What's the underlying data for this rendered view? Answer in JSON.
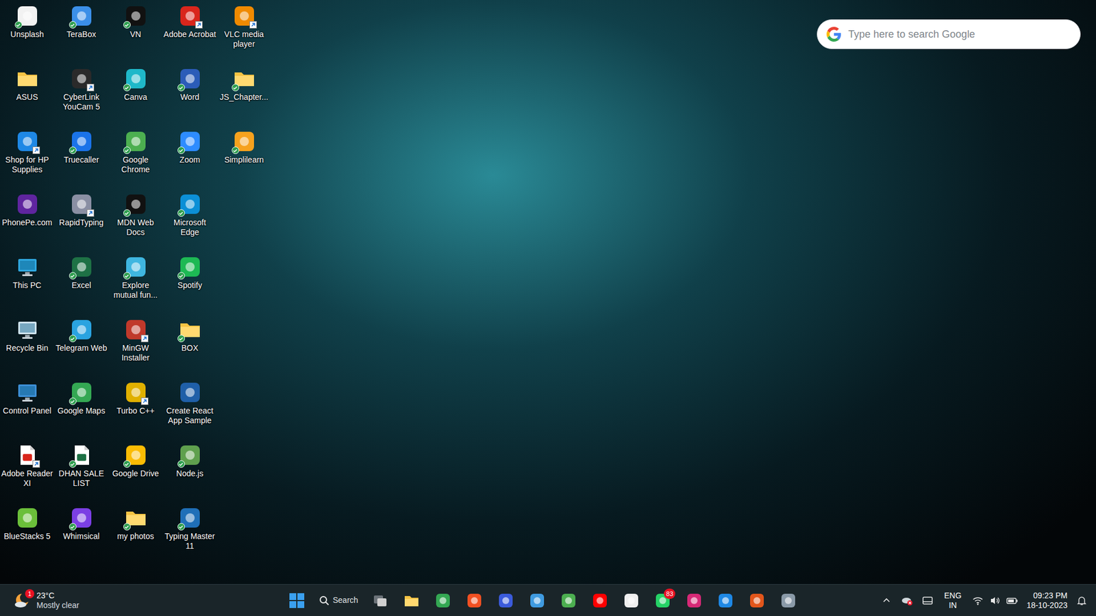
{
  "desktop": {
    "icons": [
      {
        "label": "Unsplash",
        "kind": "app",
        "color": "#f2f2f2",
        "shortcut": false,
        "synced": true
      },
      {
        "label": "ASUS",
        "kind": "folder",
        "color": "#f6c343",
        "shortcut": false,
        "synced": false
      },
      {
        "label": "Shop for HP Supplies",
        "kind": "app",
        "color": "#1e88e5",
        "shortcut": true,
        "synced": false
      },
      {
        "label": "PhonePe.com",
        "kind": "app",
        "color": "#5f259f",
        "shortcut": false,
        "synced": false
      },
      {
        "label": "This PC",
        "kind": "system",
        "color": "#2fa8e0",
        "shortcut": false,
        "synced": false
      },
      {
        "label": "Recycle Bin",
        "kind": "system",
        "color": "#cfe3ee",
        "shortcut": false,
        "synced": false
      },
      {
        "label": "Control Panel",
        "kind": "system",
        "color": "#3d8fd6",
        "shortcut": false,
        "synced": false
      },
      {
        "label": "Adobe Reader XI",
        "kind": "document",
        "color": "#d9261c",
        "shortcut": true,
        "synced": false
      },
      {
        "label": "BlueStacks 5",
        "kind": "app",
        "color": "#6bbf3a",
        "shortcut": false,
        "synced": false
      },
      {
        "label": "TeraBox",
        "kind": "app",
        "color": "#3b8fe8",
        "shortcut": false,
        "synced": true
      },
      {
        "label": "CyberLink YouCam 5",
        "kind": "app",
        "color": "#2a2a2a",
        "shortcut": true,
        "synced": false
      },
      {
        "label": "Truecaller",
        "kind": "app",
        "color": "#1a73e8",
        "shortcut": false,
        "synced": true
      },
      {
        "label": "RapidTyping",
        "kind": "app",
        "color": "#8a8fa3",
        "shortcut": true,
        "synced": false
      },
      {
        "label": "Excel",
        "kind": "app",
        "color": "#1e7145",
        "shortcut": false,
        "synced": true
      },
      {
        "label": "Telegram Web",
        "kind": "app",
        "color": "#2aa3e0",
        "shortcut": false,
        "synced": true
      },
      {
        "label": "Google Maps",
        "kind": "app",
        "color": "#34a853",
        "shortcut": false,
        "synced": true
      },
      {
        "label": "DHAN SALE LIST",
        "kind": "document",
        "color": "#1e7145",
        "shortcut": false,
        "synced": true
      },
      {
        "label": "Whimsical",
        "kind": "app",
        "color": "#7b3fe4",
        "shortcut": false,
        "synced": true
      },
      {
        "label": "VN",
        "kind": "app",
        "color": "#111111",
        "shortcut": false,
        "synced": true
      },
      {
        "label": "Canva",
        "kind": "app",
        "color": "#1fb8c9",
        "shortcut": false,
        "synced": true
      },
      {
        "label": "Google Chrome",
        "kind": "app",
        "color": "#4caf50",
        "shortcut": false,
        "synced": true
      },
      {
        "label": "MDN Web Docs",
        "kind": "app",
        "color": "#111111",
        "shortcut": false,
        "synced": true
      },
      {
        "label": "Explore mutual fun...",
        "kind": "app",
        "color": "#3fb6e0",
        "shortcut": false,
        "synced": true
      },
      {
        "label": "MinGW Installer",
        "kind": "app",
        "color": "#c0392b",
        "shortcut": true,
        "synced": false
      },
      {
        "label": "Turbo C++",
        "kind": "app",
        "color": "#e0b000",
        "shortcut": true,
        "synced": false
      },
      {
        "label": "Google Drive",
        "kind": "app",
        "color": "#fbbc04",
        "shortcut": false,
        "synced": true
      },
      {
        "label": "my photos",
        "kind": "folder",
        "color": "#f6c343",
        "shortcut": false,
        "synced": true
      },
      {
        "label": "Adobe Acrobat",
        "kind": "app",
        "color": "#d9261c",
        "shortcut": true,
        "synced": false
      },
      {
        "label": "Word",
        "kind": "app",
        "color": "#2b5cb8",
        "shortcut": false,
        "synced": true
      },
      {
        "label": "Zoom",
        "kind": "app",
        "color": "#2d8cff",
        "shortcut": false,
        "synced": true
      },
      {
        "label": "Microsoft Edge",
        "kind": "app",
        "color": "#0c8fd6",
        "shortcut": false,
        "synced": true
      },
      {
        "label": "Spotify",
        "kind": "app",
        "color": "#1db954",
        "shortcut": false,
        "synced": true
      },
      {
        "label": "BOX",
        "kind": "folder",
        "color": "#f6c343",
        "shortcut": false,
        "synced": true
      },
      {
        "label": "Create React App Sample",
        "kind": "app",
        "color": "#1f5fa8",
        "shortcut": false,
        "synced": false
      },
      {
        "label": "Node.js",
        "kind": "app",
        "color": "#5fa04e",
        "shortcut": false,
        "synced": true
      },
      {
        "label": "Typing Master 11",
        "kind": "app",
        "color": "#1f6fb8",
        "shortcut": false,
        "synced": true
      },
      {
        "label": "VLC media player",
        "kind": "app",
        "color": "#f08a00",
        "shortcut": true,
        "synced": false
      },
      {
        "label": "JS_Chapter...",
        "kind": "folder",
        "color": "#f6c343",
        "shortcut": false,
        "synced": true
      },
      {
        "label": "Simplilearn",
        "kind": "app",
        "color": "#f6a21e",
        "shortcut": false,
        "synced": true
      }
    ]
  },
  "search_widget": {
    "placeholder": "Type here to search Google"
  },
  "taskbar": {
    "weather": {
      "temperature": "23°C",
      "condition": "Mostly clear",
      "badge": "1"
    },
    "search": {
      "label": "Search"
    },
    "apps": [
      {
        "kind": "start",
        "color": "#3aa0f0"
      },
      {
        "kind": "taskview",
        "color": "#d0d0d0"
      },
      {
        "kind": "folder",
        "color": "#f6c343"
      },
      {
        "kind": "app",
        "color": "#34a853"
      },
      {
        "kind": "app",
        "color": "#f25022"
      },
      {
        "kind": "app",
        "color": "#3b5bdb"
      },
      {
        "kind": "app",
        "color": "#3f9be0"
      },
      {
        "kind": "app",
        "color": "#4caf50"
      },
      {
        "kind": "app",
        "color": "#ff0000"
      },
      {
        "kind": "app",
        "color": "#f0f0f0"
      },
      {
        "kind": "app",
        "color": "#25d366",
        "badge": "83"
      },
      {
        "kind": "app",
        "color": "#d62976"
      },
      {
        "kind": "app",
        "color": "#1e88e5"
      },
      {
        "kind": "app",
        "color": "#e2561b"
      },
      {
        "kind": "app",
        "color": "#8a9aa8"
      }
    ],
    "tray": {
      "language": "ENG",
      "region": "IN",
      "time": "09:23 PM",
      "date": "18-10-2023"
    }
  }
}
